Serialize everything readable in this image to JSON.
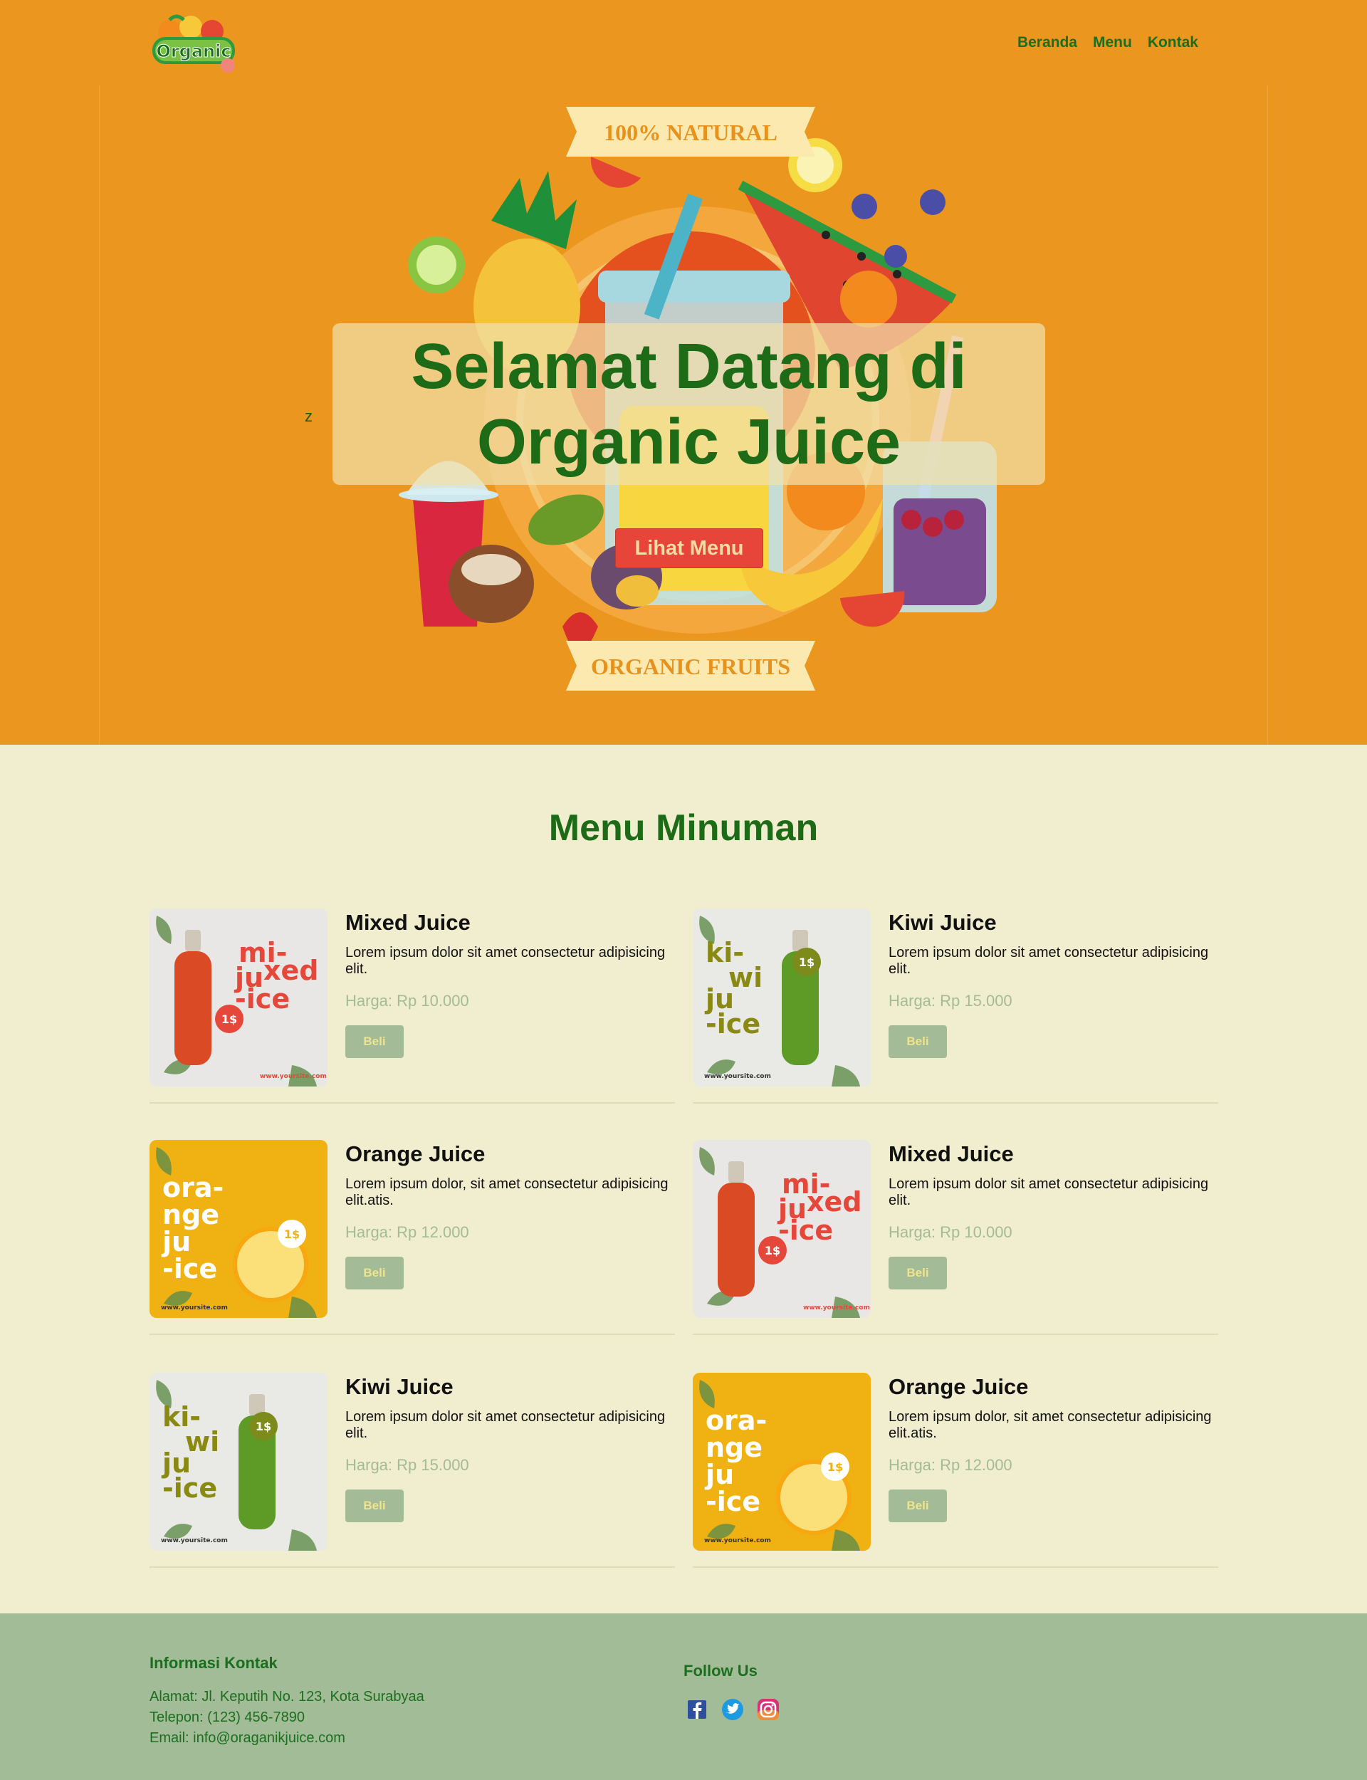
{
  "header": {
    "logo_text": "Organic",
    "nav": [
      {
        "label": "Beranda"
      },
      {
        "label": "Menu"
      },
      {
        "label": "Kontak"
      }
    ]
  },
  "hero": {
    "stray_char": "z",
    "banner_top": "100% NATURAL",
    "banner_bottom": "ORGANIC FRUITS",
    "title": "Selamat Datang di Organic Juice",
    "button": "Lihat Menu"
  },
  "menu": {
    "title": "Menu Minuman",
    "items": [
      {
        "name": "Mixed Juice",
        "desc": "Lorem ipsum dolor sit amet consectetur adipisicing elit.",
        "price": "Harga: Rp 10.000",
        "button": "Beli",
        "thumb": "mixed"
      },
      {
        "name": "Kiwi Juice",
        "desc": "Lorem ipsum dolor sit amet consectetur adipisicing elit.",
        "price": "Harga: Rp 15.000",
        "button": "Beli",
        "thumb": "kiwi"
      },
      {
        "name": "Orange Juice",
        "desc": "Lorem ipsum dolor, sit amet consectetur adipisicing elit.atis.",
        "price": "Harga: Rp 12.000",
        "button": "Beli",
        "thumb": "orange"
      },
      {
        "name": "Mixed Juice",
        "desc": "Lorem ipsum dolor sit amet consectetur adipisicing elit.",
        "price": "Harga: Rp 10.000",
        "button": "Beli",
        "thumb": "mixed"
      },
      {
        "name": "Kiwi Juice",
        "desc": "Lorem ipsum dolor sit amet consectetur adipisicing elit.",
        "price": "Harga: Rp 15.000",
        "button": "Beli",
        "thumb": "kiwi"
      },
      {
        "name": "Orange Juice",
        "desc": "Lorem ipsum dolor, sit amet consectetur adipisicing elit.atis.",
        "price": "Harga: Rp 12.000",
        "button": "Beli",
        "thumb": "orange"
      }
    ]
  },
  "thumbs": {
    "mixed": {
      "l1": "mi-",
      "l2": "ju",
      "l3": "xed",
      "l4": "-ice",
      "badge": "1$",
      "site": "www.yoursite.com"
    },
    "kiwi": {
      "l1": "ki-",
      "l2": "wi",
      "l3": "ju",
      "l4": "-ice",
      "badge": "1$",
      "site": "www.yoursite.com"
    },
    "orange": {
      "l1": "ora-",
      "l2": "nge",
      "l3": "ju",
      "l4": "-ice",
      "badge": "1$",
      "site": "www.yoursite.com"
    }
  },
  "footer": {
    "contact_title": "Informasi Kontak",
    "address": "Alamat: Jl. Keputih No. 123, Kota Surabyaa",
    "phone": "Telepon: (123) 456-7890",
    "email": "Email: info@oraganikjuice.com",
    "follow_title": "Follow Us",
    "social": [
      "facebook-icon",
      "twitter-icon",
      "instagram-icon"
    ]
  },
  "colors": {
    "hero_bg": "#eb971f",
    "page_bg": "#f1edcf",
    "accent_green": "#1d6a17",
    "button_red": "#e7453a",
    "muted_green": "#a4bb97"
  }
}
